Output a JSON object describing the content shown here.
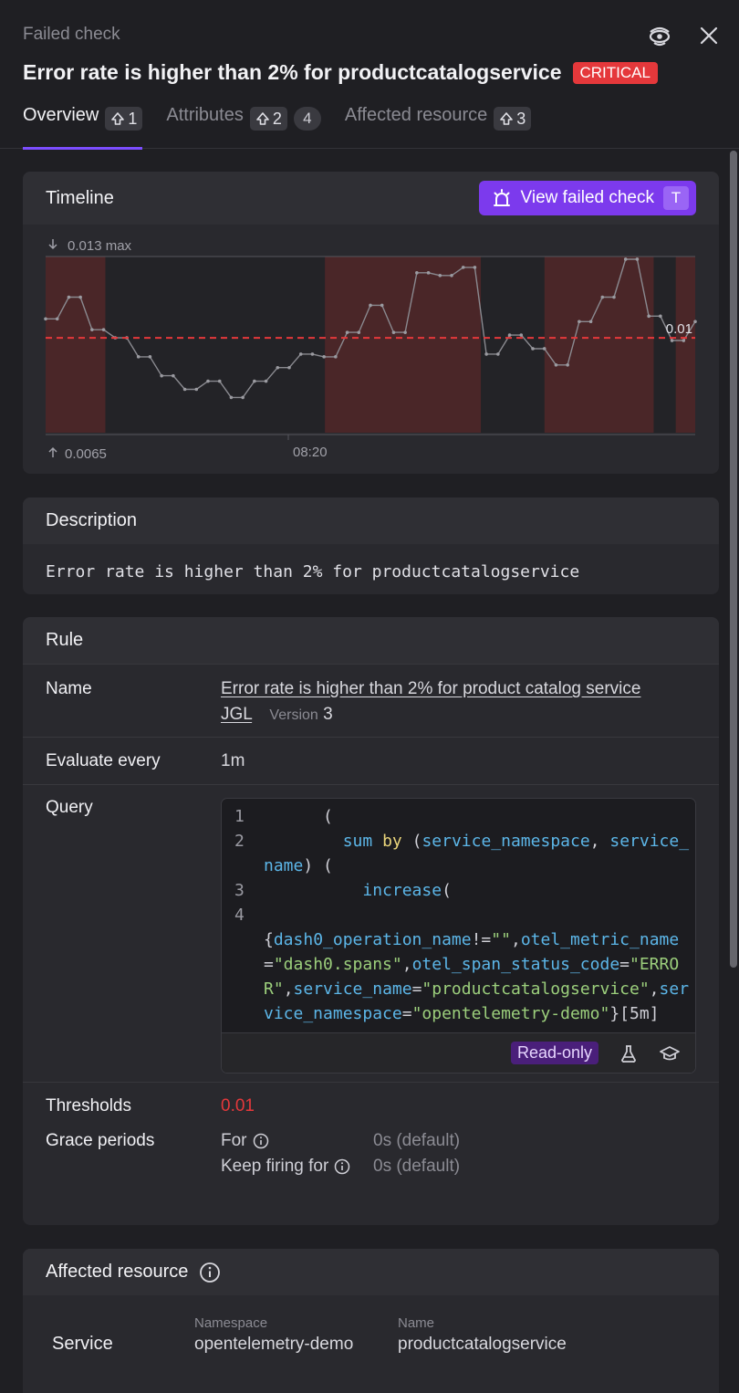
{
  "header": {
    "eyebrow": "Failed check",
    "title": "Error rate is higher than 2% for productcatalogservice",
    "severity": "CRITICAL",
    "icons": [
      "eye-pin-icon",
      "close-icon"
    ]
  },
  "tabs": [
    {
      "label": "Overview",
      "shortcut": "1",
      "active": true
    },
    {
      "label": "Attributes",
      "shortcut": "2",
      "count": "4"
    },
    {
      "label": "Affected resource",
      "shortcut": "3"
    }
  ],
  "timeline": {
    "title": "Timeline",
    "button_label": "View failed check",
    "button_shortcut": "T",
    "max_label": "0.013 max",
    "min_label": "0.0065",
    "time_label": "08:20",
    "threshold_label": "0.01"
  },
  "chart_data": {
    "type": "line",
    "ylim": [
      0.0065,
      0.013
    ],
    "threshold": 0.01,
    "xlabel": "",
    "ylabel": "",
    "x_tick": "08:20",
    "values": [
      0.0107,
      0.0107,
      0.0115,
      0.0115,
      0.0103,
      0.0103,
      0.01,
      0.01,
      0.0093,
      0.0093,
      0.0086,
      0.0086,
      0.0081,
      0.0081,
      0.0084,
      0.0084,
      0.0078,
      0.0078,
      0.0084,
      0.0084,
      0.0089,
      0.0089,
      0.0094,
      0.0094,
      0.0093,
      0.0093,
      0.0102,
      0.0102,
      0.0112,
      0.0112,
      0.0102,
      0.0102,
      0.0124,
      0.0124,
      0.0123,
      0.0123,
      0.0126,
      0.0126,
      0.0094,
      0.0094,
      0.0101,
      0.0101,
      0.0096,
      0.0096,
      0.009,
      0.009,
      0.0106,
      0.0106,
      0.0115,
      0.0115,
      0.0129,
      0.0129,
      0.0108,
      0.0108,
      0.0099,
      0.0099,
      0.0106
    ],
    "failed_ranges": [
      [
        0,
        0.092
      ],
      [
        0.43,
        0.67
      ],
      [
        0.768,
        0.936
      ],
      [
        0.97,
        1.0
      ]
    ]
  },
  "description": {
    "title": "Description",
    "text": "Error rate is higher than 2% for productcatalogservice"
  },
  "rule": {
    "title": "Rule",
    "name_label": "Name",
    "name_link": "Error rate is higher than 2% for product catalog service",
    "author": "JGL",
    "version_label": "Version",
    "version": "3",
    "evaluate_label": "Evaluate every",
    "evaluate_value": "1m",
    "query_label": "Query",
    "query_lines": [
      {
        "n": "1",
        "html": "      <span class='t-p'>(</span>"
      },
      {
        "n": "2",
        "html": "        <span class='t-fn'>sum</span> <span class='t-kw'>by</span> <span class='t-p'>(</span><span class='t-fn'>service_namespace</span><span class='t-p'>,</span> <span class='t-fn'>service_name</span><span class='t-p'>) (</span>"
      },
      {
        "n": "3",
        "html": "          <span class='t-fn'>increase</span><span class='t-p'>(</span>"
      },
      {
        "n": "4",
        "html": "<br><span class='t-p'>{</span><span class='t-fn'>dash0_operation_name</span><span class='t-p'>!=</span><span class='t-str'>\"\"</span><span class='t-p'>,</span><span class='t-fn'>otel_metric_name</span><span class='t-p'>=</span><span class='t-str'>\"dash0.spans\"</span><span class='t-p'>,</span><span class='t-fn'>otel_span_status_code</span><span class='t-p'>=</span><span class='t-str'>\"ERROR\"</span><span class='t-p'>,</span><span class='t-fn'>service_name</span><span class='t-p'>=</span><span class='t-str'>\"productcatalogservice\"</span><span class='t-p'>,</span><span class='t-fn'>service_namespace</span><span class='t-p'>=</span><span class='t-str'>\"opentelemetry-demo\"</span><span class='t-p'>}[5m]</span>"
      }
    ],
    "readonly_label": "Read-only",
    "thresholds_label": "Thresholds",
    "thresholds_value": "0.01",
    "grace_label": "Grace periods",
    "grace_for_label": "For",
    "grace_for_value": "0s (default)",
    "grace_keep_label": "Keep firing for",
    "grace_keep_value": "0s (default)"
  },
  "affected": {
    "title": "Affected resource",
    "type": "Service",
    "namespace_label": "Namespace",
    "namespace_value": "opentelemetry-demo",
    "name_label": "Name",
    "name_value": "productcatalogservice"
  },
  "colors": {
    "accent": "#7c3aed",
    "critical": "#e5383b",
    "threshold_line": "#e5383b",
    "failed_band": "#4a2628"
  }
}
